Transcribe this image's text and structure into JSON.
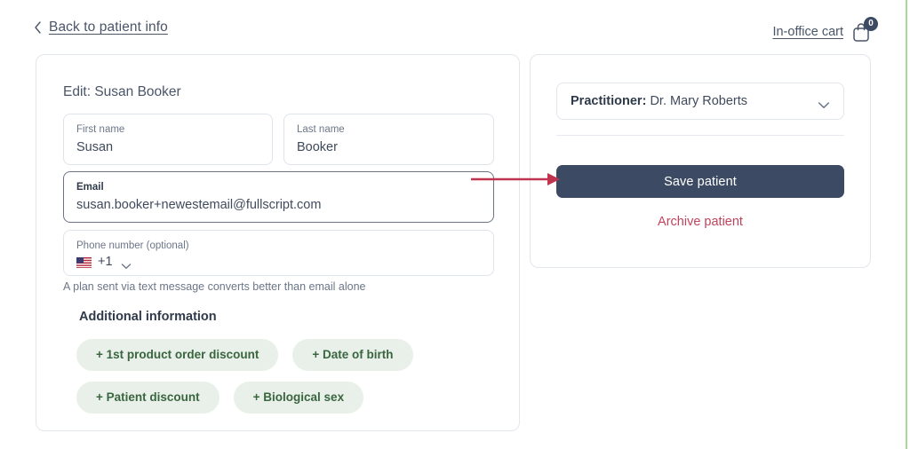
{
  "header": {
    "back_link": "Back to patient info",
    "back_icon": "chevron-left-icon",
    "cart_link": "In-office cart",
    "cart_icon": "shopping-bag-icon",
    "cart_count": "0"
  },
  "patient_form": {
    "title": "Edit: Susan Booker",
    "fields": [
      {
        "label": "First name",
        "value": "Susan",
        "focused": false
      },
      {
        "label": "Last name",
        "value": "Booker",
        "focused": false
      },
      {
        "label": "Email",
        "value": "susan.booker+newestemail@fullscript.com",
        "focused": true
      }
    ],
    "phone": {
      "label": "Phone number (optional)",
      "country_flag_icon": "us-flag-icon",
      "country_code": "+1",
      "chevron_icon": "chevron-down-icon"
    },
    "helper_text": "A plan sent via text message converts better than email alone",
    "additional_information": {
      "title": "Additional information",
      "options": [
        "+ 1st product order discount",
        "+ Date of birth",
        "+ Patient discount",
        "+ Biological sex"
      ]
    }
  },
  "actions_panel": {
    "practitioner": {
      "label": "Practitioner:",
      "value": "Dr. Mary Roberts",
      "chevron_icon": "chevron-down-icon"
    },
    "save_button": "Save patient",
    "archive_link": "Archive patient"
  },
  "annotation": {
    "arrow_icon": "arrow-right-annotation",
    "color": "#c0344f"
  },
  "colors": {
    "accent_green": "#a9d99a",
    "pill_background": "#e9f0e9",
    "pill_text": "#39653f",
    "primary_button": "#3c4b63",
    "danger_text": "#c0445c"
  }
}
